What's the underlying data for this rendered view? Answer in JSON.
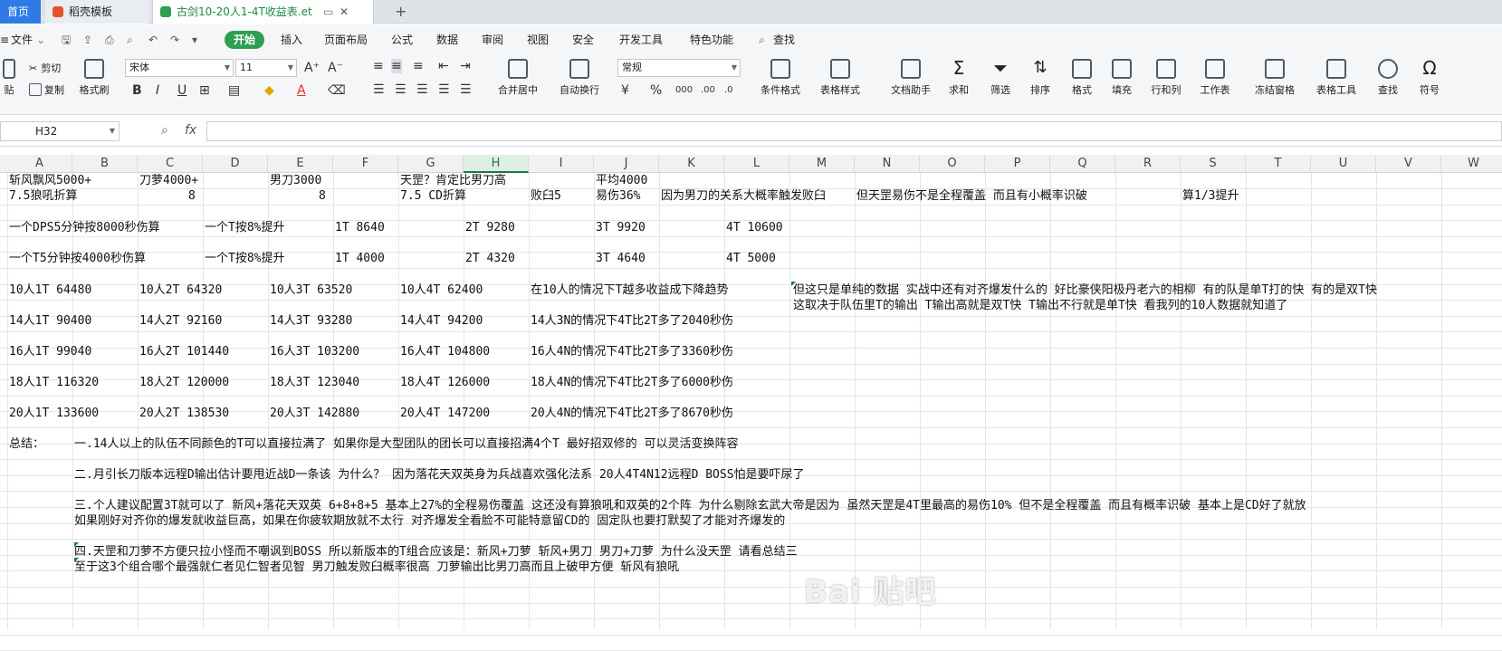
{
  "tabs": {
    "home": "首页",
    "template": "稻壳模板",
    "doc": "古剑10-20人1-4T收益表.et",
    "new_tab": "+"
  },
  "menu": {
    "file": "文件",
    "start": "开始",
    "items": [
      "插入",
      "页面布局",
      "公式",
      "数据",
      "审阅",
      "视图",
      "安全",
      "开发工具",
      "特色功能"
    ],
    "search": "查找"
  },
  "ribbon": {
    "cut": "剪切",
    "paste": "贴",
    "copy": "复制",
    "format_painter": "格式刷",
    "font": "宋体",
    "size": "11",
    "merge": "合并居中",
    "wrap": "自动换行",
    "number_format": "常规",
    "buttons": [
      "条件格式",
      "表格样式",
      "文档助手",
      "求和",
      "筛选",
      "排序",
      "格式",
      "填充",
      "行和列",
      "工作表",
      "冻结窗格",
      "表格工具",
      "查找",
      "符号"
    ]
  },
  "formula": {
    "cell_ref": "H32",
    "fx": "fx",
    "content": ""
  },
  "columns": [
    "A",
    "B",
    "C",
    "D",
    "E",
    "F",
    "G",
    "H",
    "I",
    "J",
    "K",
    "L",
    "M",
    "N",
    "O",
    "P",
    "Q",
    "R",
    "S",
    "T",
    "U",
    "V",
    "W"
  ],
  "selected_column": "H",
  "cells": {
    "r1": [
      "斩风飘风5000+",
      "刀萝4000+",
      "男刀3000",
      "天罡？肯定比男刀高",
      "平均4000"
    ],
    "r2": [
      "7.5狼吼折算",
      "8",
      "8",
      "7.5 CD折算",
      "败臼5",
      "易伤36%",
      "因为男刀的关系大概率触发败臼",
      "但天罡易伤不是全程覆盖 而且有小概率识破",
      "算1/3提升"
    ],
    "r4": [
      "一个DPS5分钟按8000秒伤算",
      "一个T按8%提升",
      "1T 8640",
      "2T 9280",
      "3T 9920",
      "4T 10600"
    ],
    "r6": [
      "一个T5分钟按4000秒伤算",
      "一个T按8%提升",
      "1T 4000",
      "2T 4320",
      "3T 4640",
      "4T 5000"
    ],
    "r8": [
      "10人1T 64480",
      "10人2T 64320",
      "10人3T 63520",
      "10人4T 62400",
      "在10人的情况下T越多收益成下降趋势",
      "但这只是单纯的数据 实战中还有对齐爆发什么的 好比豪侠阳极丹老六的相柳 有的队是单T打的快 有的是双T快"
    ],
    "r9": [
      "这取决于队伍里T的输出 T输出高就是双T快 T输出不行就是单T快 看我列的10人数据就知道了"
    ],
    "r10": [
      "14人1T 90400",
      "14人2T 92160",
      "14人3T 93280",
      "14人4T 94200",
      "14人3N的情况下4T比2T多了2040秒伤"
    ],
    "r12": [
      "16人1T 99040",
      "16人2T 101440",
      "16人3T 103200",
      "16人4T 104800",
      "16人4N的情况下4T比2T多了3360秒伤"
    ],
    "r14": [
      "18人1T 116320",
      "18人2T 120000",
      "18人3T 123040",
      "18人4T 126000",
      "18人4N的情况下4T比2T多了6000秒伤"
    ],
    "r16": [
      "20人1T 133600",
      "20人2T 138530",
      "20人3T 142880",
      "20人4T 147200",
      "20人4N的情况下4T比2T多了8670秒伤"
    ],
    "r18": [
      "总结：",
      "一.14人以上的队伍不同颜色的T可以直接拉满了  如果你是大型团队的团长可以直接招满4个T 最好招双修的 可以灵活变换阵容"
    ],
    "r20": [
      "二.月引长刀版本远程D输出估计要甩近战D一条该 为什么？ 因为落花天双英身为兵战喜欢强化法系 20人4T4N12远程D BOSS怕是要吓尿了"
    ],
    "r22": [
      "三.个人建议配置3T就可以了 新风+落花天双英 6+8+8+5 基本上27%的全程易伤覆盖 这还没有算狼吼和双英的2个阵 为什么剔除玄武大帝是因为 虽然天罡是4T里最高的易伤10% 但不是全程覆盖 而且有概率识破 基本上是CD好了就放"
    ],
    "r23": [
      "如果刚好对齐你的爆发就收益巨高，如果在你疲软期放就不太行 对齐爆发全看脸不可能特意留CD的 固定队也要打默契了才能对齐爆发的"
    ],
    "r25": [
      "四.天罡和刀萝不方便只拉小怪而不嘲讽到BOSS 所以新版本的T组合应该是：新风+刀萝    斩风+男刀    男刀+刀萝  为什么没天罡 请看总结三"
    ],
    "r26": [
      "至于这3个组合哪个最强就仁者见仁智者见智  男刀触发败臼概率很高  刀萝输出比男刀高而且上破甲方便  斩风有狼吼"
    ]
  },
  "watermark": "Bai 贴吧"
}
